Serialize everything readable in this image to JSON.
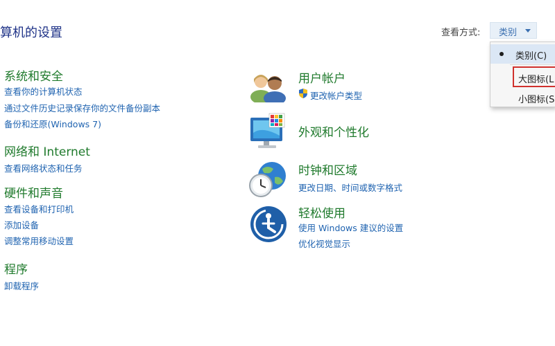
{
  "header": {
    "title": "算机的设置",
    "view_by_label": "查看方式:",
    "view_by_value": "类别"
  },
  "view_menu": {
    "options": [
      "类别(C)",
      "大图标(L",
      "小图标(S"
    ],
    "selected": "类别(C)",
    "highlighted": "大图标(L",
    "highlight_color": "#d0312d"
  },
  "left": {
    "system": {
      "title": "系统和安全",
      "links": [
        "查看你的计算机状态",
        "通过文件历史记录保存你的文件备份副本",
        "备份和还原(Windows 7)"
      ]
    },
    "network": {
      "title": "网络和 Internet",
      "links": [
        "查看网络状态和任务"
      ]
    },
    "hardware": {
      "title": "硬件和声音",
      "links": [
        "查看设备和打印机",
        "添加设备",
        "调整常用移动设置"
      ]
    },
    "programs": {
      "title": "程序",
      "links": [
        "卸载程序"
      ]
    }
  },
  "right": {
    "accounts": {
      "title": "用户帐户",
      "links": [
        "更改帐户类型"
      ],
      "icon": "users-icon",
      "link_icon": "shield-icon"
    },
    "appearance": {
      "title": "外观和个性化",
      "links": [],
      "icon": "monitor-personalize-icon"
    },
    "clock": {
      "title": "时钟和区域",
      "links": [
        "更改日期、时间或数字格式"
      ],
      "icon": "clock-globe-icon"
    },
    "ease": {
      "title": "轻松使用",
      "links": [
        "使用 Windows 建议的设置",
        "优化视觉显示"
      ],
      "icon": "ease-of-access-icon"
    }
  },
  "colors": {
    "category_heading": "#1f7a2c",
    "link": "#1f63b0",
    "title": "#1e3287"
  }
}
